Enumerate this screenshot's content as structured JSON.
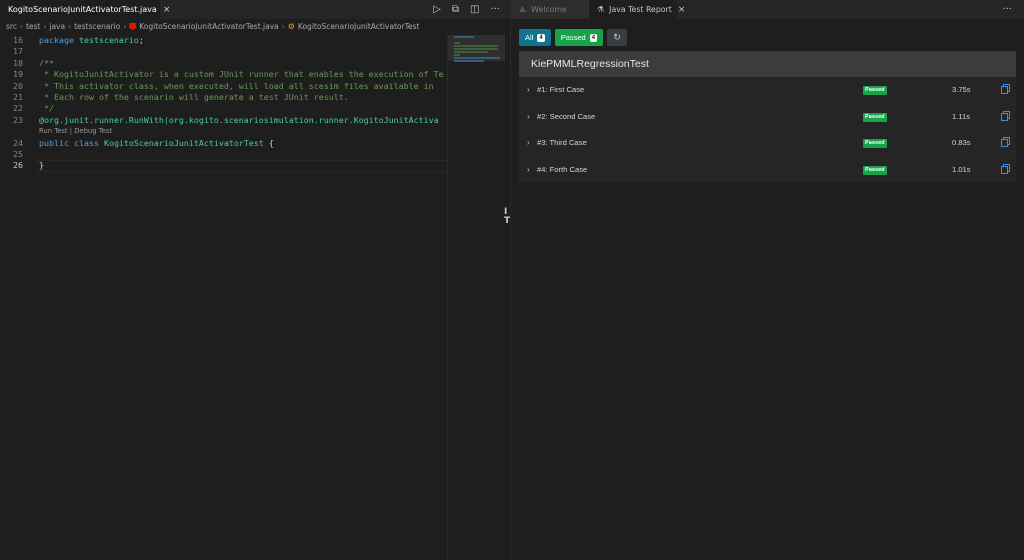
{
  "left_editor": {
    "tab": {
      "label": "KogitoScenarioJunitActivatorTest.java",
      "close": "×"
    },
    "actions": [
      "run-icon",
      "split-diff-icon",
      "split-editor-icon",
      "more-icon"
    ],
    "breadcrumb": [
      "src",
      "test",
      "java",
      "testscenario",
      "KogitoScenarioJunitActivatorTest.java",
      "KogitoScenarioJunitActivatorTest"
    ],
    "lines": [
      {
        "n": "16",
        "text": "package testscenario;"
      },
      {
        "n": "17",
        "text": ""
      },
      {
        "n": "18",
        "text": "/**"
      },
      {
        "n": "19",
        "text": " * KogitoJunitActivator is a custom JUnit runner that enables the execution of Te"
      },
      {
        "n": "20",
        "text": " * This activator class, when executed, will load all scesim files available in"
      },
      {
        "n": "21",
        "text": " * Each row of the scenario will generate a test JUnit result."
      },
      {
        "n": "22",
        "text": " */"
      },
      {
        "n": "23",
        "text": "@org.junit.runner.RunWith(org.kogito.scenariosimulation.runner.KogitoJunitActiva"
      },
      {
        "n": "24",
        "text": "public class KogitoScenarioJunitActivatorTest {"
      },
      {
        "n": "25",
        "text": ""
      },
      {
        "n": "26",
        "text": "}"
      }
    ],
    "codelens": "Run Test | Debug Test"
  },
  "right_editor": {
    "tabs": [
      {
        "label": "Welcome",
        "icon": "vscode-logo-icon",
        "active": false
      },
      {
        "label": "Java Test Report",
        "icon": "beaker-icon",
        "active": true,
        "close": "×"
      }
    ],
    "more": "···",
    "filters": {
      "all": {
        "label": "All",
        "count": "4"
      },
      "passed": {
        "label": "Passed",
        "count": "4"
      },
      "reload_icon": "refresh-icon"
    },
    "report": {
      "title": "KiePMMLRegressionTest",
      "rows": [
        {
          "name": "#1: First Case",
          "status": "Passed",
          "duration": "3.75s"
        },
        {
          "name": "#2: Second Case",
          "status": "Passed",
          "duration": "1.11s"
        },
        {
          "name": "#3: Third Case",
          "status": "Passed",
          "duration": "0.83s"
        },
        {
          "name": "#4: Forth Case",
          "status": "Passed",
          "duration": "1.01s"
        }
      ]
    }
  },
  "colors": {
    "passed": "#16a34a",
    "all": "#0e7490",
    "file_icon": "#e51400",
    "background": "#1e1e1e"
  }
}
